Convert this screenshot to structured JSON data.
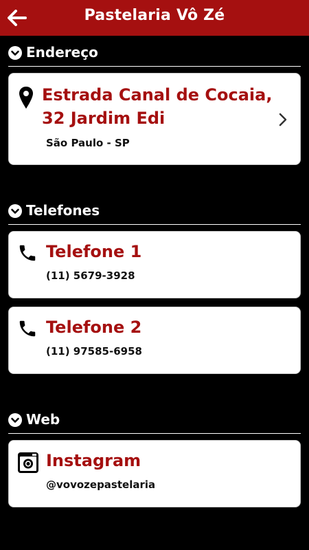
{
  "header": {
    "title": "Pastelaria Vô Zé"
  },
  "sections": {
    "address": {
      "title": "Endereço"
    },
    "phones": {
      "title": "Telefones"
    },
    "web": {
      "title": "Web"
    }
  },
  "address_card": {
    "line1": "Estrada Canal de Cocaia,",
    "line2": "32 Jardim Edi",
    "city": "São Paulo - SP"
  },
  "phone_cards": [
    {
      "label": "Telefone 1",
      "number": "(11) 5679-3928"
    },
    {
      "label": "Telefone 2",
      "number": "(11) 97585-6958"
    }
  ],
  "web_card": {
    "label": "Instagram",
    "handle": "@vovozepastelaria"
  },
  "colors": {
    "accent": "#a51010",
    "background": "#000000",
    "card": "#ffffff"
  },
  "icons": [
    "back-arrow-icon",
    "chevron-down-icon",
    "map-pin-icon",
    "chevron-right-icon",
    "phone-icon",
    "instagram-icon"
  ]
}
